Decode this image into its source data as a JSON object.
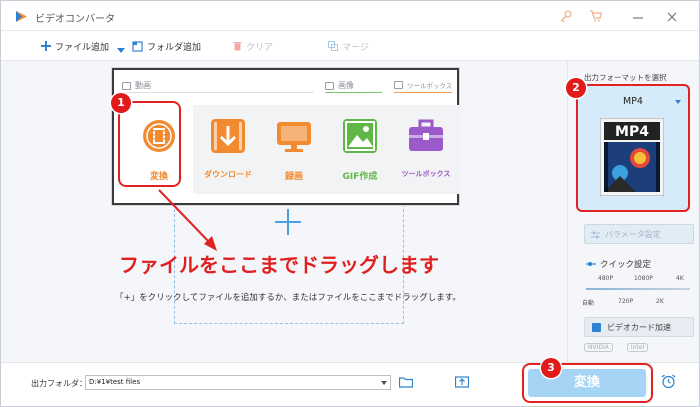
{
  "app": {
    "title": "ビデオコンバータ"
  },
  "toolbar": {
    "add_file": "ファイル追加",
    "add_folder": "フォルダ追加",
    "clear": "クリア",
    "merge": "マージ"
  },
  "panel": {
    "sections": {
      "video": "動画",
      "image": "画像",
      "tools": "ツールボックス"
    },
    "tiles": [
      {
        "label": "変換",
        "color": "#f28a30"
      },
      {
        "label": "ダウンロード",
        "color": "#f28a30"
      },
      {
        "label": "録画",
        "color": "#f28a30"
      },
      {
        "label": "GIF作成",
        "color": "#5fb845"
      },
      {
        "label": "ツールボックス",
        "color": "#9b59c9"
      }
    ]
  },
  "main": {
    "hint": "「+」をクリックしてファイルを追加するか、またはファイルをここまでドラッグします。",
    "drag_annotation": "ファイルをここまでドラッグします"
  },
  "badges": [
    "1",
    "2",
    "3"
  ],
  "right": {
    "format_title": "出力フォーマットを選択",
    "format_name": "MP4",
    "param_button": "パラメータ設定",
    "quick_label": "クイック設定",
    "ticks_top": [
      "480P",
      "1080P",
      "4K"
    ],
    "ticks_bottom": [
      "自動",
      "720P",
      "2K"
    ],
    "gpu_button": "ビデオカード加速",
    "gpu_logos": [
      "NVIDIA",
      "Intel"
    ]
  },
  "bottom": {
    "output_label": "出力フォルダ：",
    "output_path": "D:¥1¥test files",
    "convert_label": "変換"
  },
  "colors": {
    "accent": "#2f82d1",
    "annotation": "#e02222",
    "convert_bg": "#a6d4f5"
  }
}
